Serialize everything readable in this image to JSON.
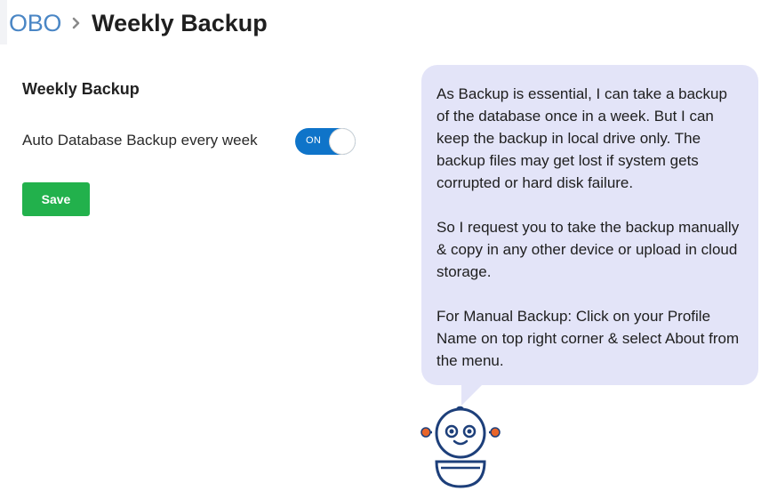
{
  "breadcrumb": {
    "parent": "OBO",
    "separator_icon": "chevron-right-icon",
    "current": "Weekly Backup"
  },
  "settings": {
    "section_title": "Weekly Backup",
    "auto_backup_label": "Auto Database Backup every week",
    "toggle_state_text": "ON",
    "toggle_on": true,
    "save_label": "Save"
  },
  "assistant": {
    "avatar_icon": "robot-assistant-icon",
    "paragraph_1": "As Backup is essential, I can take a backup of the database once in a week. But I can keep the backup in local drive only. The backup files may get lost if system gets corrupted or hard disk failure.",
    "paragraph_2": "So I request you to take the backup manually & copy in any other device or upload in cloud storage.",
    "paragraph_3": "For Manual Backup: Click on your Profile Name on top right corner & select About from the menu."
  },
  "colors": {
    "link": "#4a86c5",
    "toggle_on": "#0f74c9",
    "save_button": "#22b14c",
    "bubble_bg": "#e3e4f8",
    "robot_outline": "#1d3f7a",
    "robot_antenna": "#e8652a"
  }
}
